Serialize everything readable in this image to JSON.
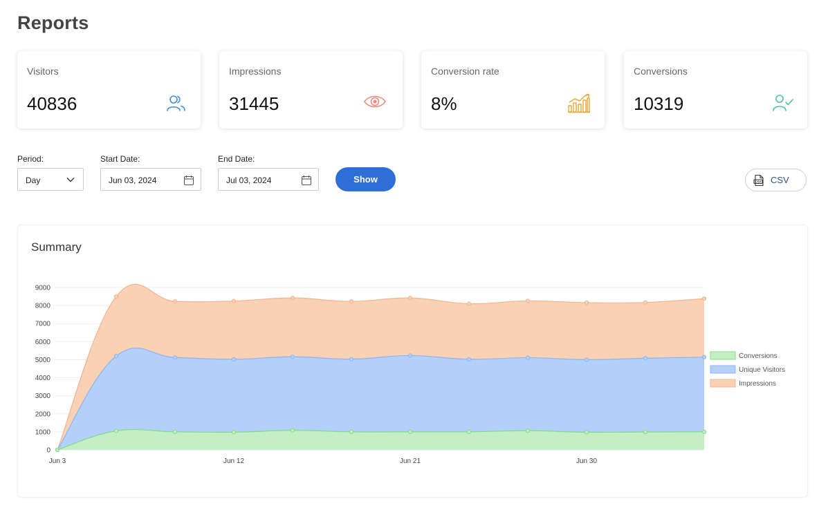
{
  "page": {
    "title": "Reports"
  },
  "stats": [
    {
      "label": "Visitors",
      "value": "40836",
      "icon": "users-icon",
      "color": "#3a8fd6"
    },
    {
      "label": "Impressions",
      "value": "31445",
      "icon": "eye-icon",
      "color": "#ef8a7a"
    },
    {
      "label": "Conversion rate",
      "value": "8%",
      "icon": "bar-chart-icon",
      "color": "#eda93a"
    },
    {
      "label": "Conversions",
      "value": "10319",
      "icon": "user-check-icon",
      "color": "#4fc49c"
    }
  ],
  "filters": {
    "period_label": "Period:",
    "period_value": "Day",
    "start_label": "Start Date:",
    "start_value": "Jun 03, 2024",
    "end_label": "End Date:",
    "end_value": "Jul 03, 2024",
    "show_label": "Show",
    "csv_label": "CSV"
  },
  "summary": {
    "title": "Summary"
  },
  "chart_data": {
    "type": "area",
    "stacked": true,
    "x": [
      "Jun 3",
      "Jun 6",
      "Jun 9",
      "Jun 12",
      "Jun 15",
      "Jun 18",
      "Jun 21",
      "Jun 24",
      "Jun 27",
      "Jun 30",
      "Jul 3",
      "Jul 6"
    ],
    "x_ticks": [
      "Jun 3",
      "Jun 12",
      "Jun 21",
      "Jun 30"
    ],
    "ylim": [
      0,
      9000
    ],
    "y_ticks": [
      "0",
      "1000",
      "2000",
      "3000",
      "4000",
      "5000",
      "6000",
      "7000",
      "8000",
      "9000"
    ],
    "series": [
      {
        "name": "Conversions",
        "color": "#7fdd7f",
        "fill": "#c4efc4",
        "values": [
          0,
          1050,
          1000,
          980,
          1080,
          1000,
          1000,
          1000,
          1060,
          980,
          990,
          1000
        ]
      },
      {
        "name": "Unique Visitors",
        "color": "#8cb4f4",
        "fill": "#b3d0fb",
        "values": [
          0,
          4150,
          4120,
          4040,
          4080,
          4030,
          4230,
          4020,
          4050,
          4020,
          4090,
          4140
        ]
      },
      {
        "name": "Impressions",
        "color": "#f2b48e",
        "fill": "#f9d1b4",
        "values": [
          0,
          3300,
          3110,
          3230,
          3260,
          3200,
          3190,
          3080,
          3150,
          3160,
          3090,
          3240
        ]
      }
    ],
    "legend_position": "right",
    "grid": true
  }
}
